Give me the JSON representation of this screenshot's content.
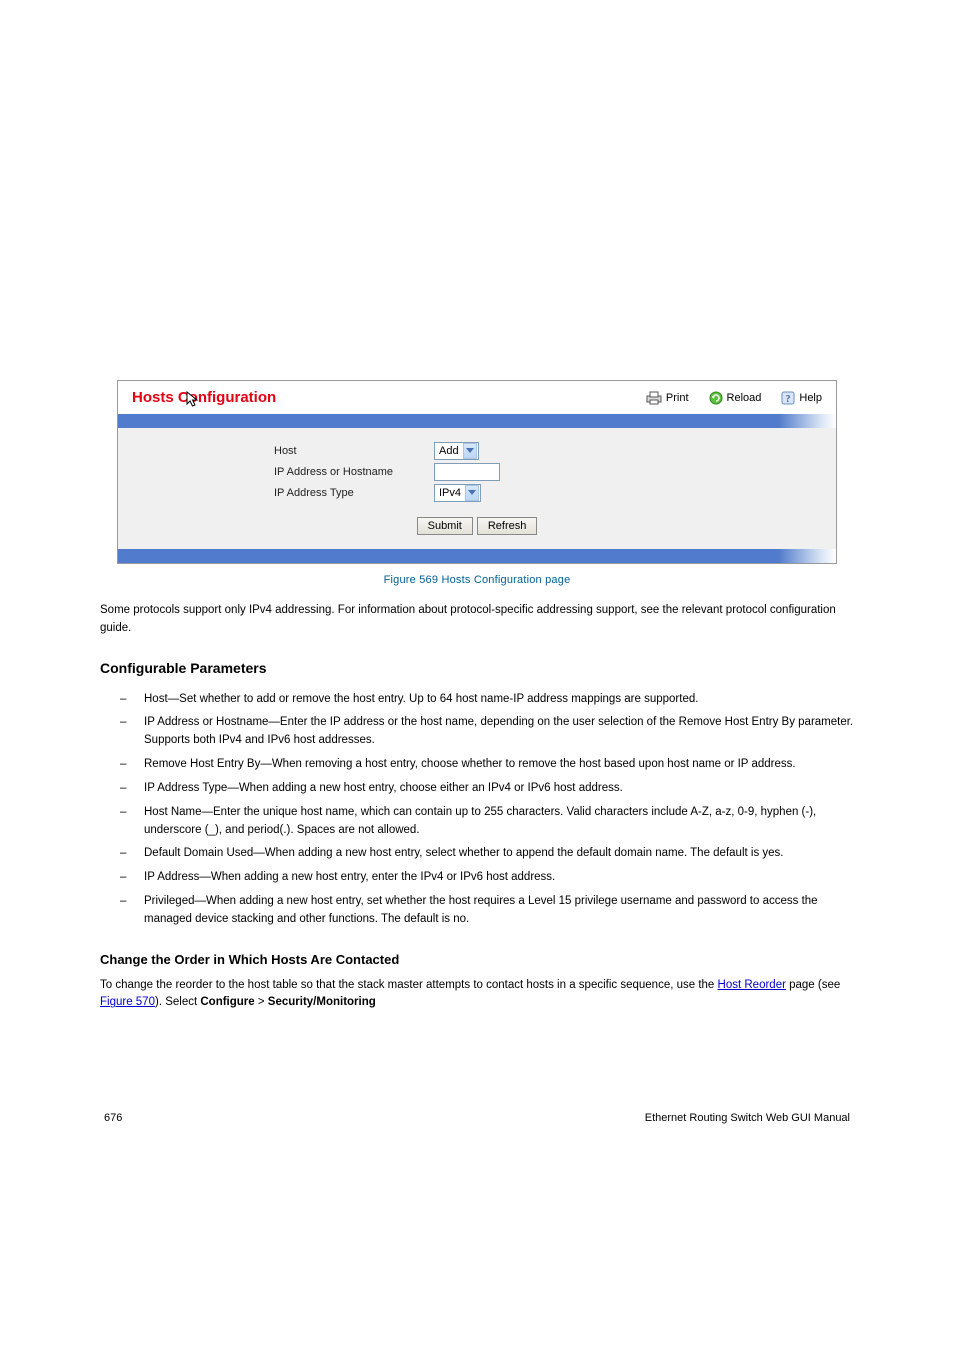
{
  "panel": {
    "title": "Hosts Configuration",
    "toolbar": {
      "print": "Print",
      "reload": "Reload",
      "help": "Help"
    },
    "form": {
      "host_label": "Host",
      "host_select": "Add",
      "ipaddr_label": "IP Address or Hostname",
      "ipaddr_value": "",
      "iptype_label": "IP Address Type",
      "iptype_select": "IPv4",
      "submit": "Submit",
      "refresh": "Refresh"
    }
  },
  "caption": "Figure 569 Hosts Configuration page",
  "para1": "Some protocols support only IPv4 addressing. For information about protocol-specific addressing support, see the relevant protocol configuration guide.",
  "heading_params": "Configurable Parameters",
  "params": [
    "Host—Set whether to add or remove the host entry. Up to 64 host name-IP address mappings are supported.",
    "IP Address or Hostname—Enter the IP address or the host name, depending on the user selection of the Remove Host Entry By parameter. Supports both IPv4 and IPv6 host addresses.",
    "Remove Host Entry By—When removing a host entry, choose whether to remove the host based upon host name or IP address.",
    "IP Address Type—When adding a new host entry, choose either an IPv4 or IPv6 host address.",
    "Host Name—Enter the unique host name, which can contain up to 255 characters. Valid characters include A-Z, a-z, 0-9, hyphen (-), underscore (_), and period(.). Spaces are not allowed.",
    "Default Domain Used—When adding a new host entry, select whether to append the default domain name. The default is yes.",
    "IP Address—When adding a new host entry, enter the IPv4 or IPv6 host address.",
    "Privileged—When adding a new host entry, set whether the host requires a Level 15 privilege username and password to access the managed device stacking and other functions. The default is no."
  ],
  "subhead": "Change the Order in Which Hosts Are Contacted",
  "para2_prefix": "To change the reorder to the host table so that the stack master attempts to contact hosts in a specific sequence, use the ",
  "para2_link": "Host Reorder",
  "para2_mid": " page (see ",
  "para2_figref": "Figure 570",
  "para2_suffix": "). Select ",
  "para2_bold1": "Configure",
  "para2_gt": " > ",
  "para2_bold2": "Security/Monitoring",
  "footer": {
    "page": "676",
    "product": "Ethernet Routing Switch Web GUI Manual"
  }
}
